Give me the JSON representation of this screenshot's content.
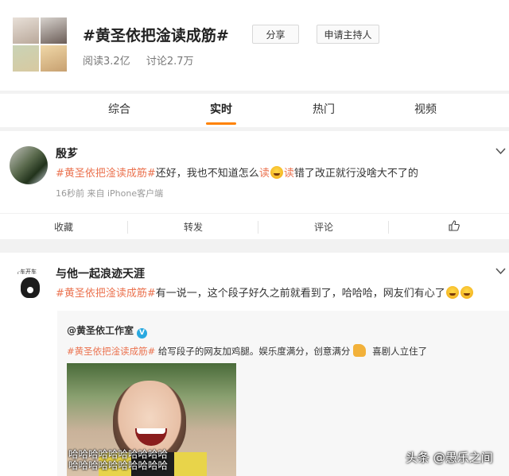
{
  "topic": {
    "title": "#黄圣依把淦读成筋#",
    "reads": "阅读3.2亿",
    "discussions": "讨论2.7万",
    "share_label": "分享",
    "host_label": "申请主持人"
  },
  "tabs": [
    {
      "label": "综合"
    },
    {
      "label": "实时"
    },
    {
      "label": "热门"
    },
    {
      "label": "视频"
    }
  ],
  "active_tab": "实时",
  "posts": [
    {
      "username": "殷芗",
      "hashtag": "#黄圣依把淦读成筋#",
      "text_a": "还好，我也不知道怎么",
      "hl_a": "读",
      "hl_b": "读",
      "text_b": "错了改正就行没啥大不了的",
      "meta": "16秒前  来自 iPhone客户端",
      "actions": {
        "collect": "收藏",
        "repost": "转发",
        "comment": "评论"
      }
    },
    {
      "username": "与他一起浪迹天涯",
      "avatar_caption": "开车开车",
      "hashtag": "#黄圣依把淦读成筋#",
      "text": "有一说一，这个段子好久之前就看到了，哈哈哈，网友们有心了",
      "repost": {
        "user": "@黄圣依工作室",
        "hashtag": "#黄圣依把淦读成筋#",
        "text_a": " 给写段子的网友加鸡腿。娱乐度满分，创意满分",
        "text_b": " 喜剧人立住了",
        "image_caption_1": "哈哈哈哈哈哈哈哈哈哈",
        "image_caption_2": "哈哈哈哈哈哈哈哈哈哈"
      }
    }
  ],
  "watermark": "头条 @愚乐之间",
  "colors": {
    "accent": "#ff8200",
    "hashtag": "#eb7350",
    "link": "#1e6ac9"
  }
}
